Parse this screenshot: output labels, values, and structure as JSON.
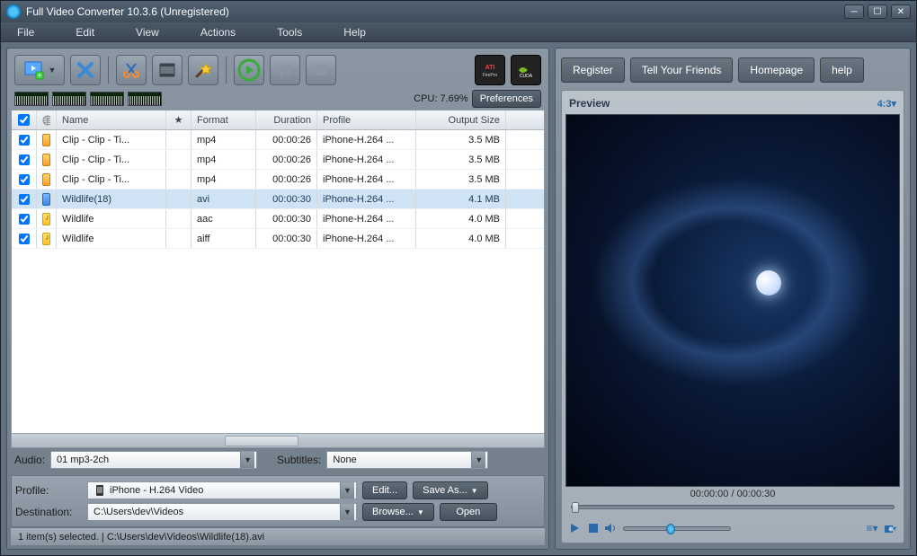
{
  "title": "Full Video Converter 10.3.6 (Unregistered)",
  "menu": {
    "file": "File",
    "edit": "Edit",
    "view": "View",
    "actions": "Actions",
    "tools": "Tools",
    "help": "Help"
  },
  "cpu": {
    "label": "CPU: 7.69%"
  },
  "preferences_btn": "Preferences",
  "columns": {
    "name": "Name",
    "format": "Format",
    "duration": "Duration",
    "profile": "Profile",
    "output_size": "Output Size"
  },
  "rows": [
    {
      "checked": true,
      "icon": "video",
      "name": "Clip - Clip - Ti...",
      "format": "mp4",
      "duration": "00:00:26",
      "profile": "iPhone-H.264 ...",
      "size": "3.5 MB",
      "selected": false
    },
    {
      "checked": true,
      "icon": "video",
      "name": "Clip - Clip - Ti...",
      "format": "mp4",
      "duration": "00:00:26",
      "profile": "iPhone-H.264 ...",
      "size": "3.5 MB",
      "selected": false
    },
    {
      "checked": true,
      "icon": "video",
      "name": "Clip - Clip - Ti...",
      "format": "mp4",
      "duration": "00:00:26",
      "profile": "iPhone-H.264 ...",
      "size": "3.5 MB",
      "selected": false
    },
    {
      "checked": true,
      "icon": "video-blue",
      "name": "Wildlife(18)",
      "format": "avi",
      "duration": "00:00:30",
      "profile": "iPhone-H.264 ...",
      "size": "4.1 MB",
      "selected": true
    },
    {
      "checked": true,
      "icon": "audio",
      "name": "Wildlife",
      "format": "aac",
      "duration": "00:00:30",
      "profile": "iPhone-H.264 ...",
      "size": "4.0 MB",
      "selected": false
    },
    {
      "checked": true,
      "icon": "audio",
      "name": "Wildlife",
      "format": "aiff",
      "duration": "00:00:30",
      "profile": "iPhone-H.264 ...",
      "size": "4.0 MB",
      "selected": false
    }
  ],
  "audio": {
    "label": "Audio:",
    "value": "01 mp3-2ch"
  },
  "subtitles": {
    "label": "Subtitles:",
    "value": "None"
  },
  "profile": {
    "label": "Profile:",
    "value": "iPhone - H.264 Video"
  },
  "destination": {
    "label": "Destination:",
    "value": "C:\\Users\\dev\\Videos"
  },
  "buttons": {
    "edit": "Edit...",
    "save_as": "Save As...",
    "browse": "Browse...",
    "open": "Open"
  },
  "status": "1 item(s) selected. | C:\\Users\\dev\\Videos\\Wildlife(18).avi",
  "right_buttons": {
    "register": "Register",
    "tell": "Tell Your Friends",
    "home": "Homepage",
    "help": "help"
  },
  "preview": {
    "title": "Preview",
    "ratio": "4:3",
    "time": "00:00:00 / 00:00:30"
  }
}
